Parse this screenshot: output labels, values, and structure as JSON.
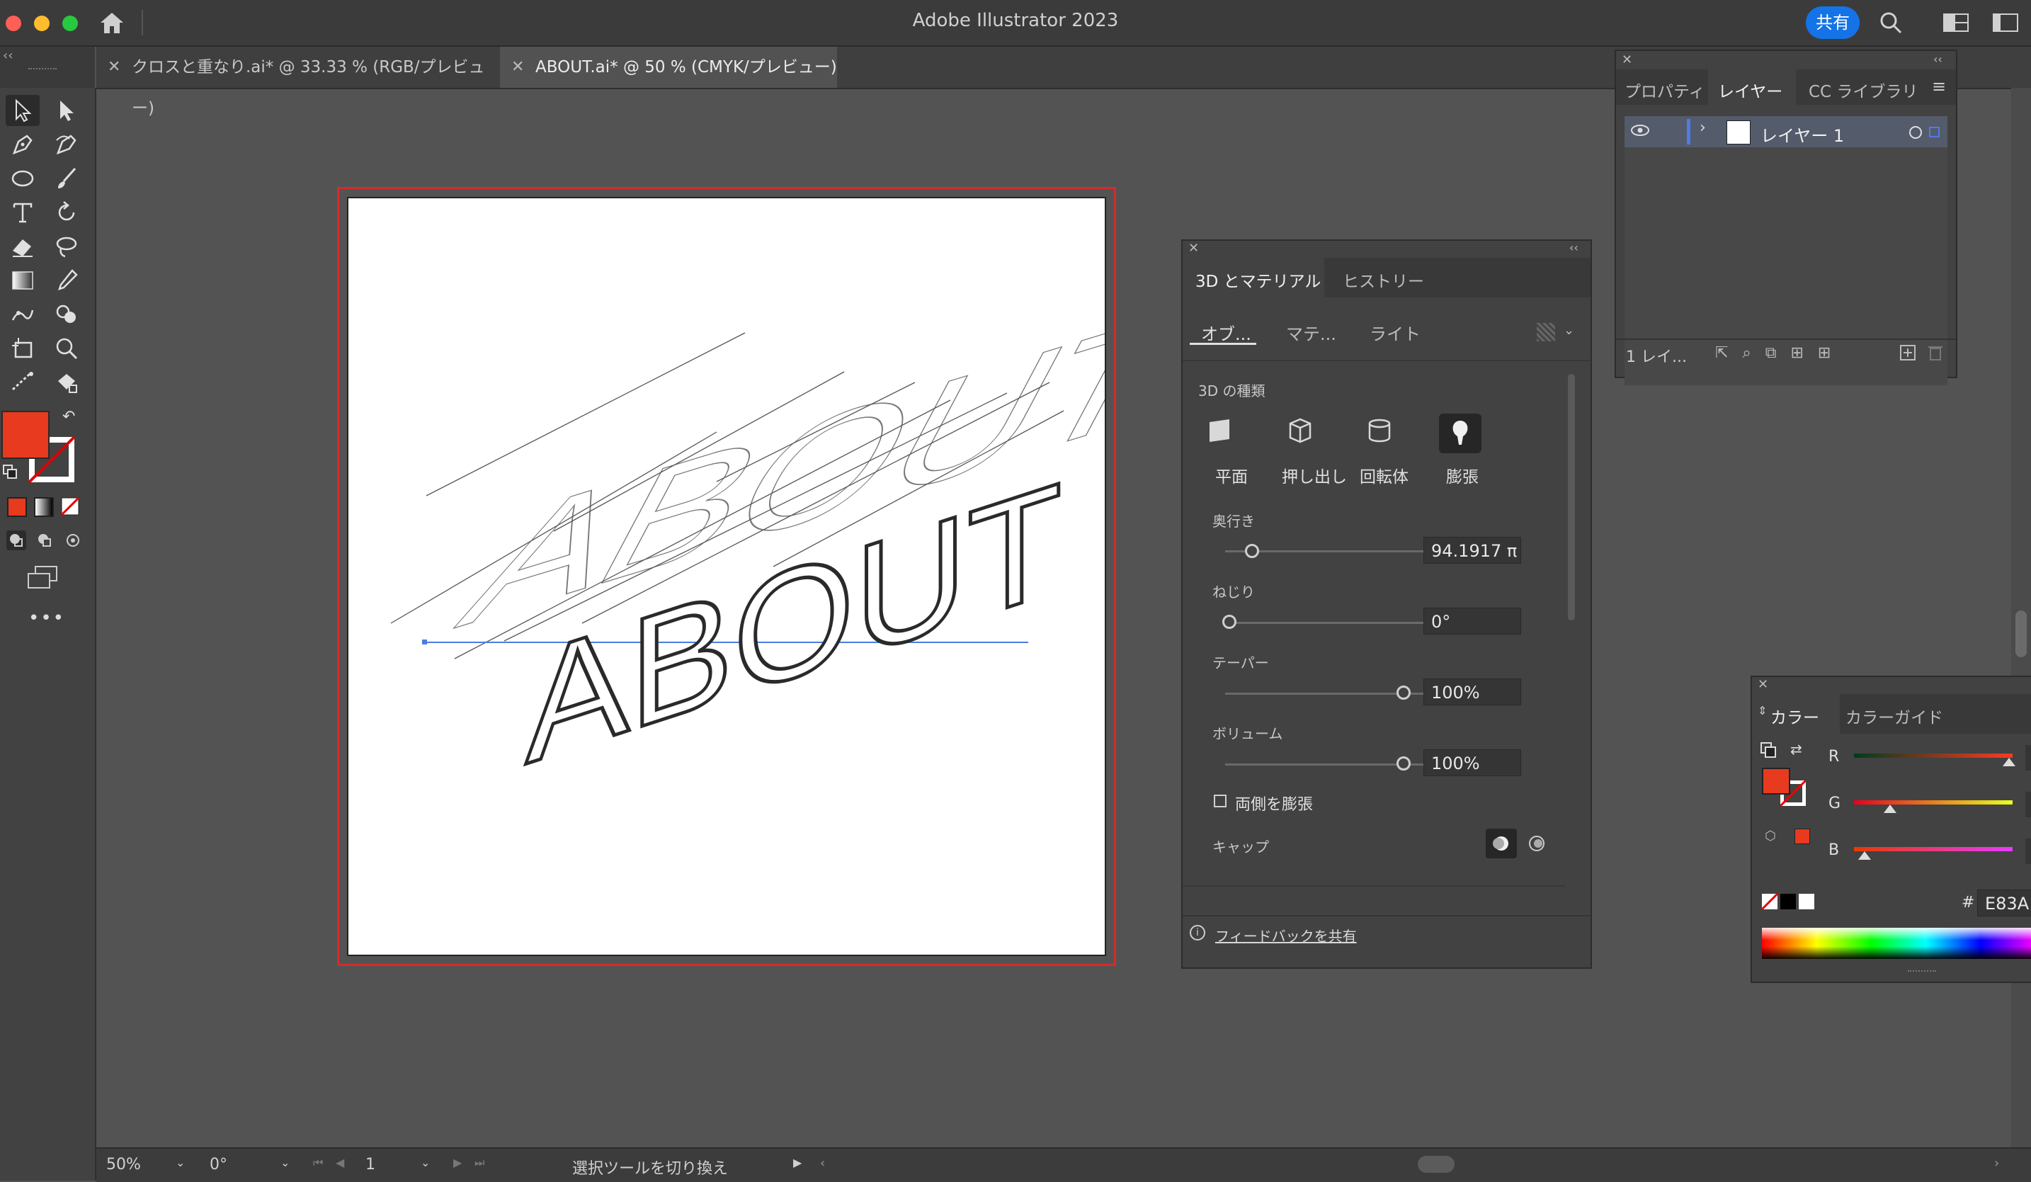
{
  "app": {
    "title": "Adobe Illustrator 2023",
    "share_label": "共有"
  },
  "tabs": [
    {
      "label": "クロスと重なり.ai* @ 33.33 % (RGB/プレビュー)",
      "active": false
    },
    {
      "label": "ABOUT.ai* @ 50 % (CMYK/プレビュー)",
      "active": true
    }
  ],
  "toolbar": {
    "fill_color": "#E83A1E",
    "more_label": "•••"
  },
  "artwork": {
    "back_text": "ABOUT",
    "front_text": "ABOUT"
  },
  "layers_panel": {
    "tabs": [
      "プロパティ",
      "レイヤー",
      "CC ライブラリ"
    ],
    "active_tab": "レイヤー",
    "layer_name": "レイヤー 1",
    "footer_count": "1 レイ..."
  },
  "panel_3d": {
    "tabs": [
      "3D とマテリアル",
      "ヒストリー"
    ],
    "subtabs": [
      "オブ...",
      "マテ...",
      "ライト"
    ],
    "section_title": "3D の種類",
    "types": [
      {
        "label": "平面",
        "icon": "plane-icon"
      },
      {
        "label": "押し出し",
        "icon": "extrude-icon"
      },
      {
        "label": "回転体",
        "icon": "revolve-icon"
      },
      {
        "label": "膨張",
        "icon": "inflate-icon"
      }
    ],
    "selected_type": "膨張",
    "depth_label": "奥行き",
    "depth_value": "94.1917 π",
    "twist_label": "ねじり",
    "twist_value": "0°",
    "taper_label": "テーパー",
    "taper_value": "100%",
    "volume_label": "ボリューム",
    "volume_value": "100%",
    "both_sides_label": "両側を膨張",
    "cap_label": "キャップ",
    "feedback_label": "フィードバックを共有"
  },
  "color_panel": {
    "tabs": [
      "カラー",
      "カラーガイド"
    ],
    "r_label": "R",
    "g_label": "G",
    "b_label": "B",
    "r_value": 232,
    "g_value": 58,
    "b_value": 30,
    "hash_label": "#",
    "hex_value": "E83A",
    "fill_color": "#E83A1E"
  },
  "statusbar": {
    "zoom": "50%",
    "rotation": "0°",
    "artboard_number": "1",
    "status_text": "選択ツールを切り換え"
  }
}
